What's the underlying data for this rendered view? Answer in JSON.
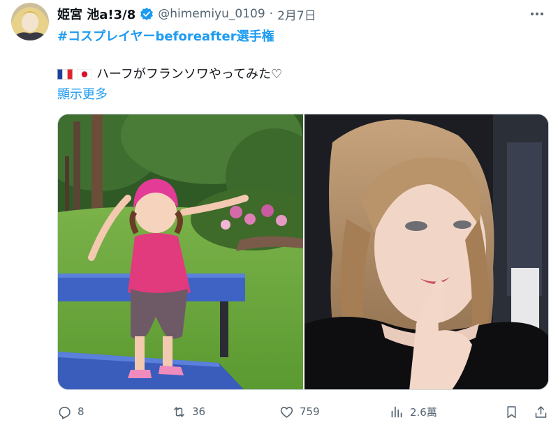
{
  "tweet": {
    "display_name": "姫宮 池a!3/8",
    "handle": "@himemiyu_0109",
    "separator": "·",
    "date": "2月7日",
    "hashtag": "#コスプレイヤーbeforeafter選手権",
    "text": "ハーフがフランソワやってみた♡",
    "flags": [
      "france-flag",
      "japan-flag"
    ],
    "show_more": "顯示更多"
  },
  "media": {
    "left_image": "before-photo-child-on-bench",
    "right_image": "after-photo-cosplay-selfie"
  },
  "actions": {
    "reply_count": "8",
    "retweet_count": "36",
    "like_count": "759",
    "views_count": "2.6萬"
  },
  "icons": [
    "verified-badge-icon",
    "more-options-icon",
    "reply-icon",
    "retweet-icon",
    "like-icon",
    "views-icon",
    "bookmark-icon",
    "share-icon"
  ],
  "colors": {
    "accent": "#1d9bf0",
    "secondary_text": "#536471",
    "text": "#0f1419"
  }
}
